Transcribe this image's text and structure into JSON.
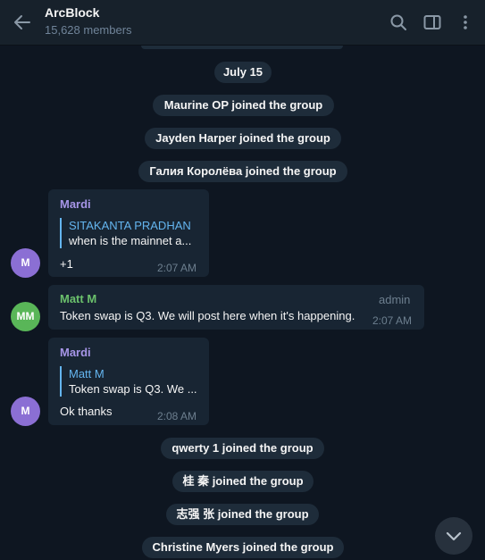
{
  "header": {
    "title": "ArcBlock",
    "subtitle": "15,628 members",
    "icons": [
      "back-arrow-icon",
      "search-icon",
      "sidebar-toggle-icon",
      "more-vertical-icon"
    ]
  },
  "date_separator": "July 15",
  "service_messages": {
    "s1": "Maurine OP joined the group",
    "s2": "Jayden Harper joined the group",
    "s3": "Галия Королёва joined the group",
    "s4": "qwerty 1 joined the group",
    "s5": "桂 秦 joined the group",
    "s6": "志强 张 joined the group",
    "s7": "Christine Myers joined the group"
  },
  "messages": [
    {
      "author": "Mardi",
      "reply_author": "SITAKANTA PRADHAN",
      "reply_text": "when is the mainnet a...",
      "text": "+1",
      "time": "2:07 AM",
      "avatar": "M"
    },
    {
      "author": "Matt M",
      "badge": "admin",
      "text": "Token swap is Q3.  We will post here when it's happening.",
      "time": "2:07 AM",
      "avatar": "MM"
    },
    {
      "author": "Mardi",
      "reply_author": "Matt M",
      "reply_text": "Token swap is Q3.  We ...",
      "text": "Ok thanks",
      "time": "2:08 AM",
      "avatar": "M"
    }
  ],
  "colors": {
    "background": "#0e1621",
    "header": "#17212b",
    "bubble": "#182533",
    "service_pill": "#1e2c3a",
    "accent_link": "#64b5ef",
    "mardi_name": "#a695e7",
    "matt_name": "#6bc16c",
    "avatar_purple": "#8b6fd4",
    "avatar_green": "#59b658"
  }
}
